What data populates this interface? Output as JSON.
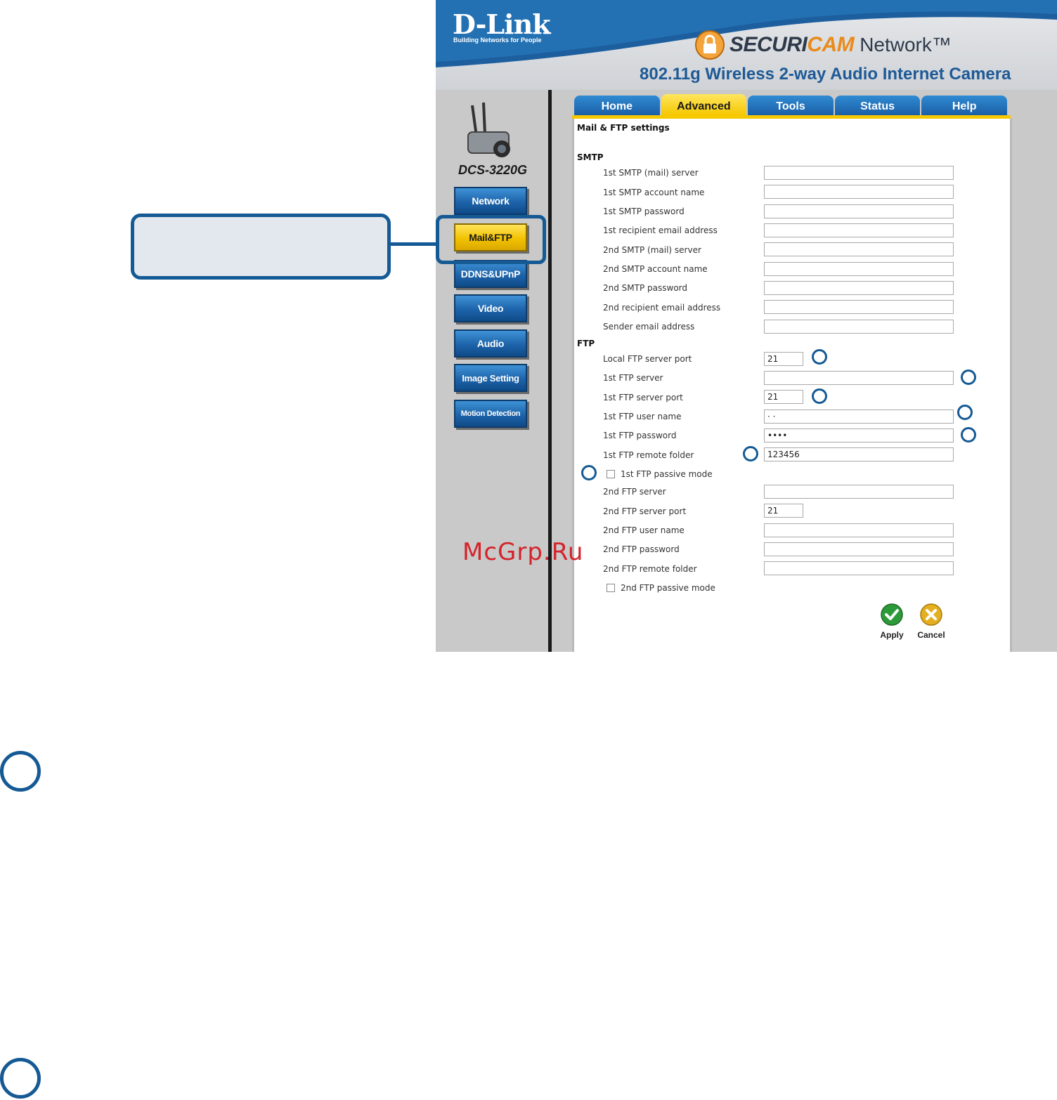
{
  "header": {
    "brand": "D-Link",
    "tagline": "Building Networks for People",
    "product_line_a": "SECURI",
    "product_line_b": "CAM",
    "product_line_c": "Network™",
    "subtitle": "802.11g Wireless 2-way Audio Internet Camera"
  },
  "sidebar": {
    "model": "DCS-3220G",
    "items": [
      {
        "label": "Network",
        "active": false
      },
      {
        "label": "Mail&FTP",
        "active": true
      },
      {
        "label": "DDNS&UPnP",
        "active": false
      },
      {
        "label": "Video",
        "active": false
      },
      {
        "label": "Audio",
        "active": false
      },
      {
        "label": "Image Setting",
        "active": false
      },
      {
        "label": "Motion Detection",
        "active": false
      }
    ]
  },
  "tabs": [
    {
      "label": "Home",
      "active": false
    },
    {
      "label": "Advanced",
      "active": true
    },
    {
      "label": "Tools",
      "active": false
    },
    {
      "label": "Status",
      "active": false
    },
    {
      "label": "Help",
      "active": false
    }
  ],
  "panel": {
    "title": "Mail & FTP settings",
    "smtp_section": "SMTP",
    "smtp_fields": [
      {
        "label": "1st SMTP (mail) server",
        "value": ""
      },
      {
        "label": "1st SMTP account name",
        "value": ""
      },
      {
        "label": "1st SMTP password",
        "value": ""
      },
      {
        "label": "1st recipient email address",
        "value": ""
      },
      {
        "label": "2nd SMTP (mail) server",
        "value": ""
      },
      {
        "label": "2nd SMTP account name",
        "value": ""
      },
      {
        "label": "2nd SMTP password",
        "value": ""
      },
      {
        "label": "2nd recipient email address",
        "value": ""
      },
      {
        "label": "Sender email address",
        "value": ""
      }
    ],
    "ftp_section": "FTP",
    "ftp_local_port": {
      "label": "Local FTP server port",
      "value": "21"
    },
    "ftp1_server": {
      "label": "1st FTP server",
      "value": ""
    },
    "ftp1_port": {
      "label": "1st FTP server port",
      "value": "21"
    },
    "ftp1_user": {
      "label": "1st FTP user name",
      "value": "· ·"
    },
    "ftp1_password": {
      "label": "1st FTP password",
      "value": "••••"
    },
    "ftp1_folder": {
      "label": "1st FTP remote folder",
      "value": "123456"
    },
    "ftp1_passive": {
      "label": "1st FTP passive mode",
      "checked": false
    },
    "ftp2_server": {
      "label": "2nd FTP server",
      "value": ""
    },
    "ftp2_port": {
      "label": "2nd FTP server port",
      "value": "21"
    },
    "ftp2_user": {
      "label": "2nd FTP user name",
      "value": ""
    },
    "ftp2_password": {
      "label": "2nd FTP password",
      "value": ""
    },
    "ftp2_folder": {
      "label": "2nd FTP remote folder",
      "value": ""
    },
    "ftp2_passive": {
      "label": "2nd FTP passive mode",
      "checked": false
    },
    "apply_label": "Apply",
    "cancel_label": "Cancel"
  },
  "watermark": "McGrp.Ru",
  "colors": {
    "accent_blue": "#155a94",
    "tab_blue": "#1b5fa6",
    "active_yellow": "#f5c800",
    "watermark_red": "#d4232a"
  }
}
